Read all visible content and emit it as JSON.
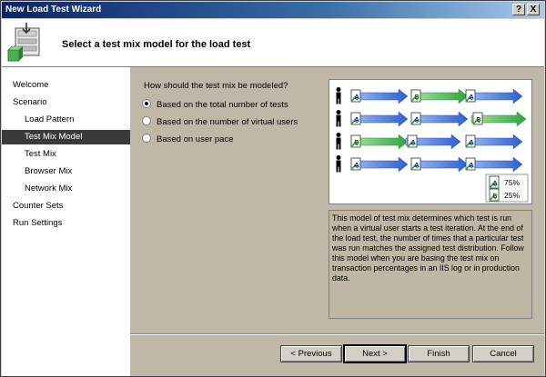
{
  "window": {
    "title": "New Load Test Wizard",
    "help_label": "?",
    "close_label": "X"
  },
  "header": {
    "heading": "Select a test mix model for the load test"
  },
  "nav": {
    "items": [
      {
        "label": "Welcome",
        "level": "top",
        "selected": false
      },
      {
        "label": "Scenario",
        "level": "top",
        "selected": false
      },
      {
        "label": "Load Pattern",
        "level": "sub",
        "selected": false
      },
      {
        "label": "Test Mix Model",
        "level": "sub",
        "selected": true
      },
      {
        "label": "Test Mix",
        "level": "sub",
        "selected": false
      },
      {
        "label": "Browser Mix",
        "level": "sub",
        "selected": false
      },
      {
        "label": "Network Mix",
        "level": "sub",
        "selected": false
      },
      {
        "label": "Counter Sets",
        "level": "top",
        "selected": false
      },
      {
        "label": "Run Settings",
        "level": "top",
        "selected": false
      }
    ]
  },
  "main": {
    "question": "How should the test mix be modeled?",
    "options": [
      {
        "label": "Based on the total number of tests",
        "checked": true
      },
      {
        "label": "Based on the number of virtual users",
        "checked": false
      },
      {
        "label": "Based on user pace",
        "checked": false
      }
    ],
    "diagram": {
      "legend": [
        {
          "test": "A",
          "percent": "75%"
        },
        {
          "test": "B",
          "percent": "25%"
        }
      ],
      "colors": {
        "test_a_arrow": "#3d6fd6",
        "test_b_arrow": "#38b04a"
      }
    },
    "description": "This model of test mix determines which test is run when a virtual user starts a test iteration. At the end of the load test, the number of times that a particular test was run matches the assigned test distribution. Follow this model when you are basing the test mix on transaction percentages in an IIS log or in production data."
  },
  "buttons": {
    "previous": "< Previous",
    "next": "Next >",
    "finish": "Finish",
    "cancel": "Cancel"
  }
}
